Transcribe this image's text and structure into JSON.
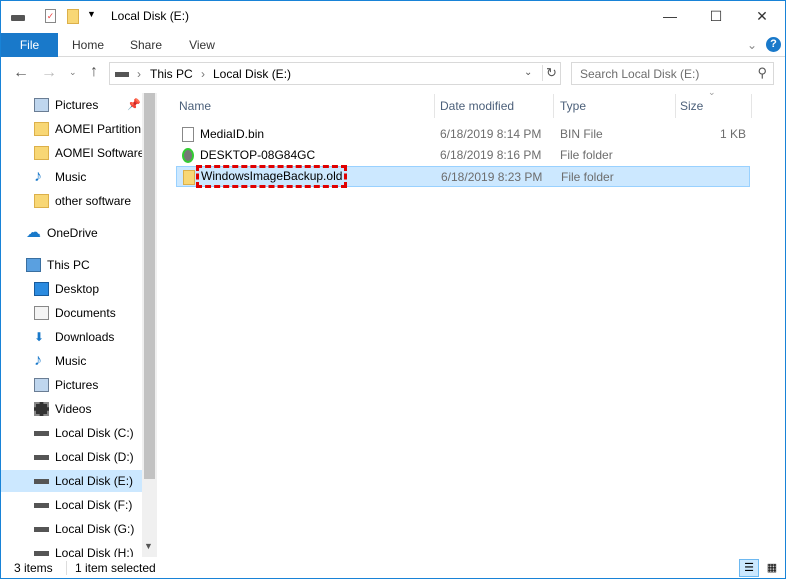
{
  "window": {
    "title": "Local Disk (E:)",
    "minimize": "—",
    "maximize": "☐",
    "close": "✕"
  },
  "ribbon": {
    "tabs": [
      "File",
      "Home",
      "Share",
      "View"
    ],
    "help": "?",
    "collapse": "⌄"
  },
  "address": {
    "crumbs": [
      "This PC",
      "Local Disk (E:)"
    ],
    "search_placeholder": "Search Local Disk (E:)"
  },
  "nav": {
    "quick": [
      {
        "label": "Pictures",
        "icon": "pictures-icon"
      },
      {
        "label": "AOMEI Partition",
        "icon": "folder-icon"
      },
      {
        "label": "AOMEI Software",
        "icon": "folder-icon"
      },
      {
        "label": "Music",
        "icon": "music-icon"
      },
      {
        "label": "other software",
        "icon": "folder-icon"
      }
    ],
    "onedrive": "OneDrive",
    "thispc": "This PC",
    "pc": [
      {
        "label": "Desktop",
        "icon": "desktop-icon"
      },
      {
        "label": "Documents",
        "icon": "documents-icon"
      },
      {
        "label": "Downloads",
        "icon": "downloads-icon"
      },
      {
        "label": "Music",
        "icon": "music-icon"
      },
      {
        "label": "Pictures",
        "icon": "pictures-icon"
      },
      {
        "label": "Videos",
        "icon": "videos-icon"
      },
      {
        "label": "Local Disk (C:)",
        "icon": "drive-icon"
      },
      {
        "label": "Local Disk (D:)",
        "icon": "drive-icon"
      },
      {
        "label": "Local Disk (E:)",
        "icon": "drive-icon"
      },
      {
        "label": "Local Disk (F:)",
        "icon": "drive-icon"
      },
      {
        "label": "Local Disk (G:)",
        "icon": "drive-icon"
      },
      {
        "label": "Local Disk (H:)",
        "icon": "drive-icon"
      }
    ]
  },
  "columns": {
    "name": "Name",
    "date": "Date modified",
    "type": "Type",
    "size": "Size"
  },
  "files": [
    {
      "name": "MediaID.bin",
      "date": "6/18/2019 8:14 PM",
      "type": "BIN File",
      "size": "1 KB"
    },
    {
      "name": "DESKTOP-08G84GC",
      "date": "6/18/2019 8:16 PM",
      "type": "File folder",
      "size": ""
    },
    {
      "name": "WindowsImageBackup.old",
      "date": "6/18/2019 8:23 PM",
      "type": "File folder",
      "size": ""
    }
  ],
  "status": {
    "count": "3 items",
    "selected": "1 item selected"
  },
  "colors": {
    "accent": "#1979ca",
    "selection": "#cce8ff",
    "highlight": "#e00000"
  }
}
